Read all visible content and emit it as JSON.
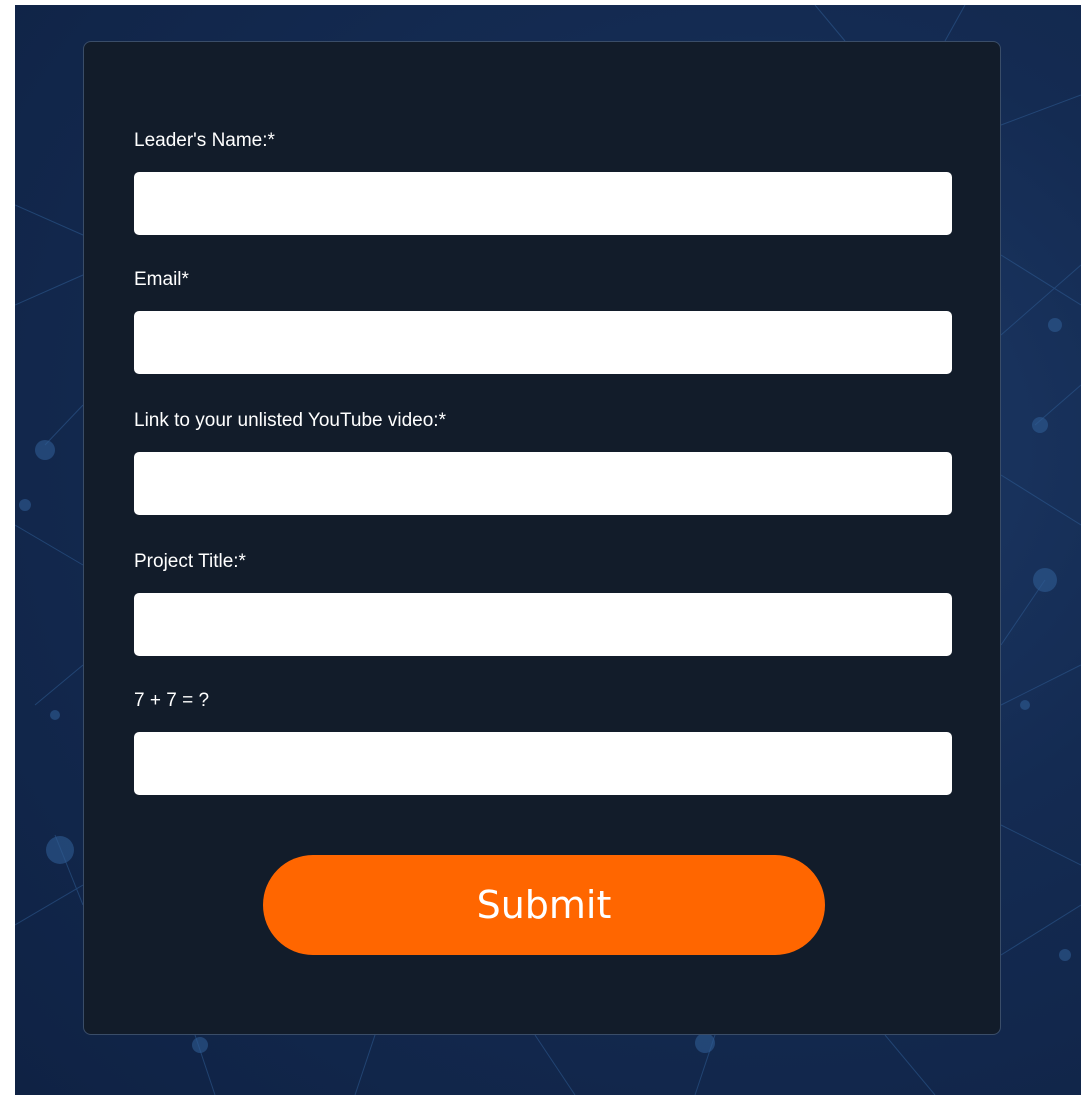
{
  "form": {
    "fields": [
      {
        "label": "Leader's Name:*",
        "value": "",
        "placeholder": ""
      },
      {
        "label": "Email*",
        "value": "",
        "placeholder": ""
      },
      {
        "label": "Link to your unlisted YouTube video:*",
        "value": "",
        "placeholder": ""
      },
      {
        "label": "Project Title:*",
        "value": "",
        "placeholder": ""
      },
      {
        "label": "7 + 7 = ?",
        "value": "",
        "placeholder": ""
      }
    ],
    "submit_label": "Submit"
  },
  "colors": {
    "background": "#142b52",
    "card": "#121c2a",
    "card_border": "#3a4d68",
    "button": "#ff6600",
    "text": "#ffffff"
  }
}
